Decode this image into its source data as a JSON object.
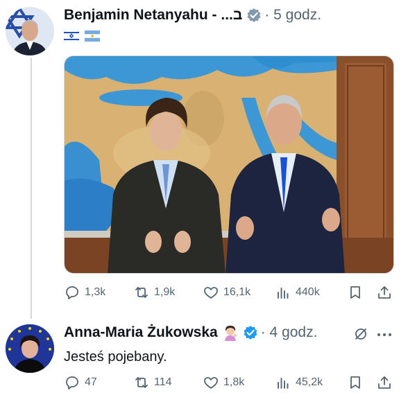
{
  "post": {
    "author_name": "Benjamin Netanyahu - ...ב",
    "time": "· 5 godz.",
    "flags": [
      "israel-flag",
      "argentina-flag"
    ],
    "actions": {
      "replies": "1,3k",
      "reposts": "1,9k",
      "likes": "16,1k",
      "views": "440k"
    }
  },
  "reply": {
    "author_name": "Anna-Maria Żukowska",
    "time": "· 4 godz.",
    "text": "Jesteś pojebany.",
    "actions": {
      "replies": "47",
      "reposts": "114",
      "likes": "1,8k",
      "views": "45,2k"
    }
  },
  "colors": {
    "verified": "#1d9bf0",
    "muted": "#536471",
    "text": "#0f1419",
    "line": "#cfd9de"
  },
  "icons": [
    "reply-icon",
    "repost-icon",
    "like-icon",
    "views-icon",
    "bookmark-icon",
    "share-icon",
    "verified-badge-icon",
    "more-icon",
    "muted-icon"
  ]
}
